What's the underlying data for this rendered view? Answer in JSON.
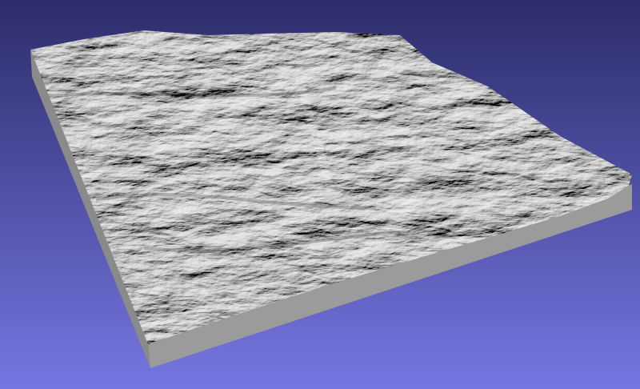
{
  "viewport": {
    "background_top": "#2c2c6a",
    "background_bottom": "#7676e2",
    "model": "terrain-mesh",
    "surface_color": "#a8a8a8",
    "front_face_color": "#9b9b9b",
    "side_face_color": "#8a8a8a"
  }
}
